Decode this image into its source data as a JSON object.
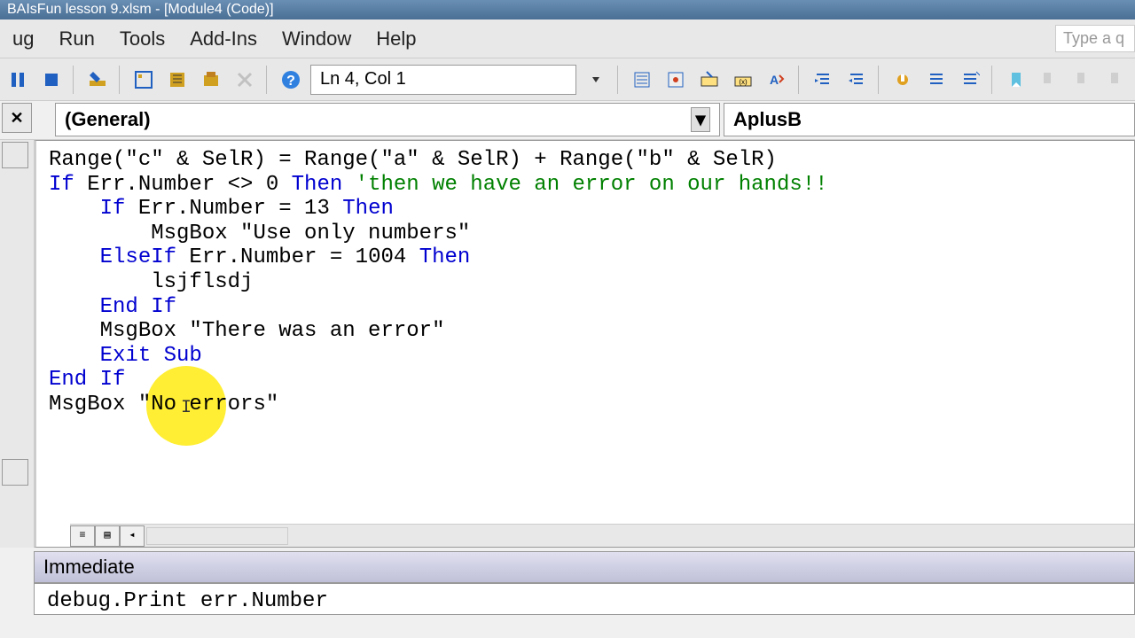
{
  "title": "BAIsFun lesson 9.xlsm - [Module4 (Code)]",
  "menu": {
    "items": [
      "ug",
      "Run",
      "Tools",
      "Add-Ins",
      "Window",
      "Help"
    ],
    "type_prompt": "Type a q"
  },
  "toolbar": {
    "position": "Ln 4, Col 1"
  },
  "dropdowns": {
    "general": "(General)",
    "proc": "AplusB"
  },
  "code": {
    "l1": "Range(\"c\" & SelR) = Range(\"a\" & SelR) + Range(\"b\" & SelR)",
    "l2": "",
    "l3_if": "If",
    "l3_mid": " Err.Number <> 0 ",
    "l3_then": "Then ",
    "l3_comment": "'then we have an error on our hands!!",
    "l4_if": "    If",
    "l4_mid": " Err.Number = 13 ",
    "l4_then": "Then",
    "l5": "        MsgBox \"Use only numbers\"",
    "l6_elseif": "    ElseIf",
    "l6_mid": " Err.Number = 1004 ",
    "l6_then": "Then",
    "l7": "        lsjflsdj",
    "l8": "    End If",
    "l9": "",
    "l10": "    MsgBox \"There was an error\"",
    "l11_exit": "    Exit Sub",
    "l12": "End If",
    "l13": "",
    "l14": "MsgBox \"No errors\""
  },
  "immediate": {
    "title": "Immediate",
    "content": "debug.Print err.Number"
  }
}
